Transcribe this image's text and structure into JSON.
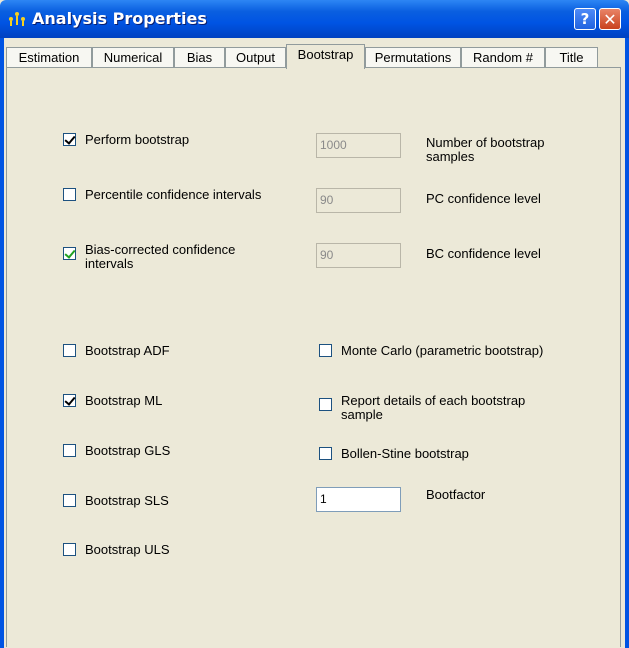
{
  "window": {
    "title": "Analysis Properties",
    "help_label": "?",
    "close_label": "✕"
  },
  "tabs": [
    {
      "label": "Estimation"
    },
    {
      "label": "Numerical"
    },
    {
      "label": "Bias"
    },
    {
      "label": "Output"
    },
    {
      "label": "Bootstrap",
      "active": true
    },
    {
      "label": "Permutations"
    },
    {
      "label": "Random #"
    },
    {
      "label": "Title"
    }
  ],
  "bootstrap": {
    "perform": {
      "label": "Perform bootstrap",
      "checked": true
    },
    "percentile": {
      "label": "Percentile confidence intervals",
      "checked": false
    },
    "bias_corrected": {
      "label": "Bias-corrected confidence intervals",
      "checked": true
    },
    "num_samples": {
      "value": "1000",
      "label": "Number of bootstrap samples"
    },
    "pc_level": {
      "value": "90",
      "label": "PC confidence level"
    },
    "bc_level": {
      "value": "90",
      "label": "BC confidence level"
    },
    "adf": {
      "label": "Bootstrap ADF",
      "checked": false
    },
    "ml": {
      "label": "Bootstrap ML",
      "checked": true
    },
    "gls": {
      "label": "Bootstrap GLS",
      "checked": false
    },
    "sls": {
      "label": "Bootstrap SLS",
      "checked": false
    },
    "uls": {
      "label": "Bootstrap ULS",
      "checked": false
    },
    "monte_carlo": {
      "label": "Monte Carlo (parametric bootstrap)",
      "checked": false
    },
    "report_details": {
      "label": "Report details of each bootstrap sample",
      "checked": false
    },
    "bollen_stine": {
      "label": "Bollen-Stine bootstrap",
      "checked": false
    },
    "bootfactor": {
      "value": "1",
      "label": "Bootfactor"
    }
  },
  "colors": {
    "titlebar": "#0054e3",
    "dialog_bg": "#ece9d8"
  }
}
